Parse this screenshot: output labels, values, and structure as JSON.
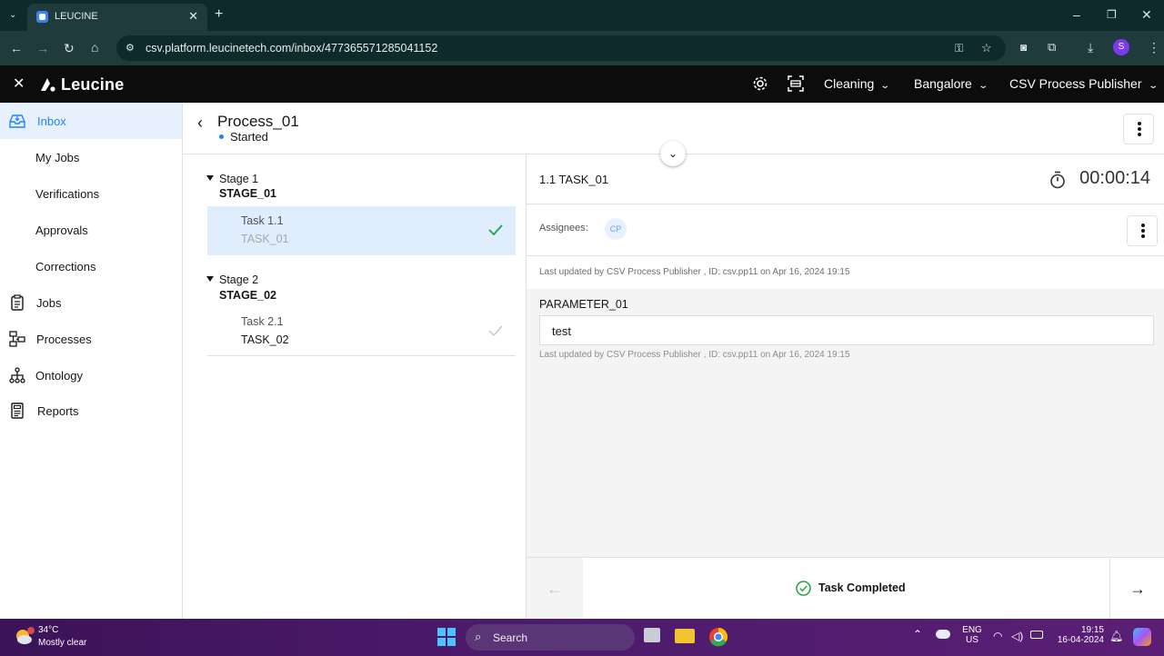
{
  "browser": {
    "tab_title": "LEUCINE",
    "url": "csv.platform.leucinetech.com/inbox/477365571285041152",
    "profile_initial": "S"
  },
  "app": {
    "brand": "Leucine",
    "header": {
      "facility_dropdown": "Cleaning",
      "site_dropdown": "Bangalore",
      "user_dropdown": "CSV Process Publisher"
    }
  },
  "sidebar": {
    "items": [
      {
        "label": "Inbox",
        "icon": "inbox-icon",
        "active": true
      },
      {
        "label": "My Jobs"
      },
      {
        "label": "Verifications"
      },
      {
        "label": "Approvals"
      },
      {
        "label": "Corrections"
      },
      {
        "label": "Jobs",
        "icon": "clipboard-icon"
      },
      {
        "label": "Processes",
        "icon": "flowchart-icon"
      },
      {
        "label": "Ontology",
        "icon": "hierarchy-icon"
      },
      {
        "label": "Reports",
        "icon": "report-icon"
      }
    ]
  },
  "process": {
    "name": "Process_01",
    "state": "Started"
  },
  "stages": [
    {
      "label": "Stage 1",
      "name": "STAGE_01",
      "tasks": [
        {
          "number": "Task 1.1",
          "name": "TASK_01",
          "completed": true,
          "selected": true
        }
      ]
    },
    {
      "label": "Stage 2",
      "name": "STAGE_02",
      "tasks": [
        {
          "number": "Task 2.1",
          "name": "TASK_02",
          "completed": false,
          "selected": false
        }
      ]
    }
  ],
  "task_panel": {
    "title": "1.1 TASK_01",
    "timer": "00:00:14",
    "assignees_label": "Assignees:",
    "assignee_initials": "CP",
    "last_updated": "Last updated by CSV Process Publisher , ID: csv.pp11 on Apr 16, 2024 19:15",
    "parameter_label": "PARAMETER_01",
    "parameter_value": "test",
    "parameter_last_updated": "Last updated by CSV Process Publisher , ID: csv.pp11 on Apr 16, 2024 19:15",
    "footer_status": "Task Completed"
  },
  "taskbar": {
    "temperature": "34°C",
    "weather": "Mostly clear",
    "search_placeholder": "Search",
    "lang_1": "ENG",
    "lang_2": "US",
    "time": "19:15",
    "date": "16-04-2024"
  },
  "colors": {
    "accent_blue": "#1d84ff",
    "success_green": "#24a148",
    "header_bg": "#0c0c0c"
  }
}
